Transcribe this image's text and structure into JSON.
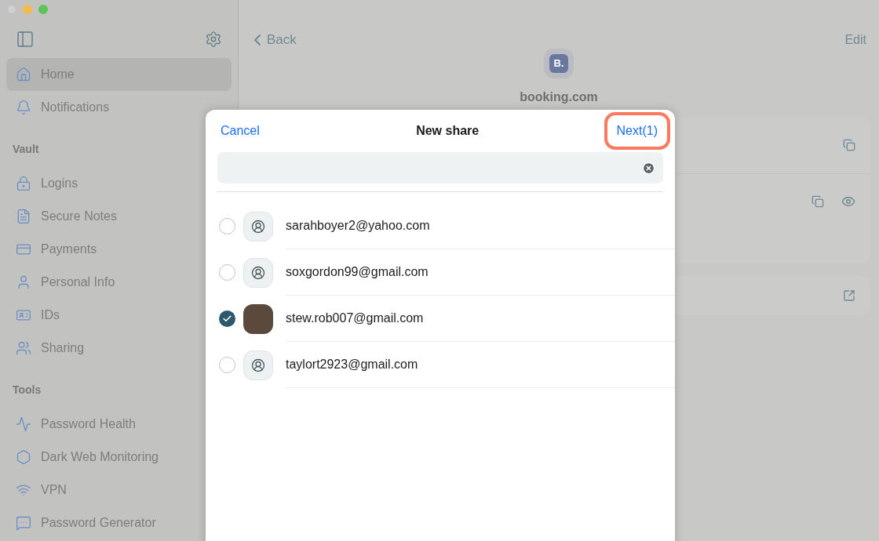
{
  "sidebar": {
    "items": [
      {
        "label": "Home",
        "selected": true
      },
      {
        "label": "Notifications",
        "selected": false
      }
    ],
    "sections": [
      {
        "title": "Vault",
        "items": [
          {
            "label": "Logins",
            "selected": false
          },
          {
            "label": "Secure Notes",
            "selected": false
          },
          {
            "label": "Payments",
            "selected": false
          },
          {
            "label": "Personal Info",
            "selected": false
          },
          {
            "label": "IDs",
            "selected": false
          },
          {
            "label": "Sharing",
            "selected": false
          }
        ]
      },
      {
        "title": "Tools",
        "items": [
          {
            "label": "Password Health",
            "selected": false
          },
          {
            "label": "Dark Web Monitoring",
            "selected": false
          },
          {
            "label": "VPN",
            "selected": false
          },
          {
            "label": "Password Generator",
            "selected": false
          }
        ]
      }
    ]
  },
  "detail": {
    "back": "Back",
    "edit": "Edit",
    "logo_letter": "B.",
    "title": "booking.com"
  },
  "dialog": {
    "cancel": "Cancel",
    "title": "New share",
    "next": "Next(1)",
    "contacts": [
      {
        "email": "sarahboyer2@yahoo.com",
        "kind": "generic",
        "selected": false
      },
      {
        "email": "soxgordon99@gmail.com",
        "kind": "generic",
        "selected": false
      },
      {
        "email": "stew.rob007@gmail.com",
        "kind": "photo",
        "selected": true
      },
      {
        "email": "taylort2923@gmail.com",
        "kind": "generic",
        "selected": false
      }
    ]
  }
}
